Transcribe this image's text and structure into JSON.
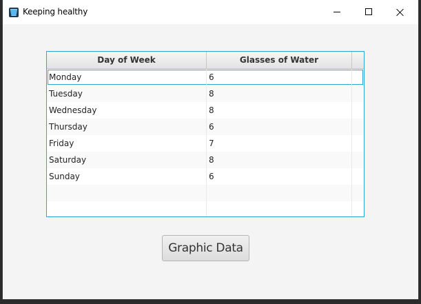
{
  "window": {
    "title": "Keeping healthy",
    "icon": "water-glass-icon"
  },
  "table": {
    "columns": [
      "Day of Week",
      "Glasses of Water"
    ],
    "rows": [
      {
        "day": "Monday",
        "glasses": "6"
      },
      {
        "day": "Tuesday",
        "glasses": "8"
      },
      {
        "day": "Wednesday",
        "glasses": "8"
      },
      {
        "day": "Thursday",
        "glasses": "6"
      },
      {
        "day": "Friday",
        "glasses": "7"
      },
      {
        "day": "Saturday",
        "glasses": "8"
      },
      {
        "day": "Sunday",
        "glasses": "6"
      }
    ],
    "selected_row": "Monday"
  },
  "button": {
    "label": "Graphic Data"
  },
  "colors": {
    "focus": "#29a8d6",
    "background": "#f4f4f4"
  }
}
